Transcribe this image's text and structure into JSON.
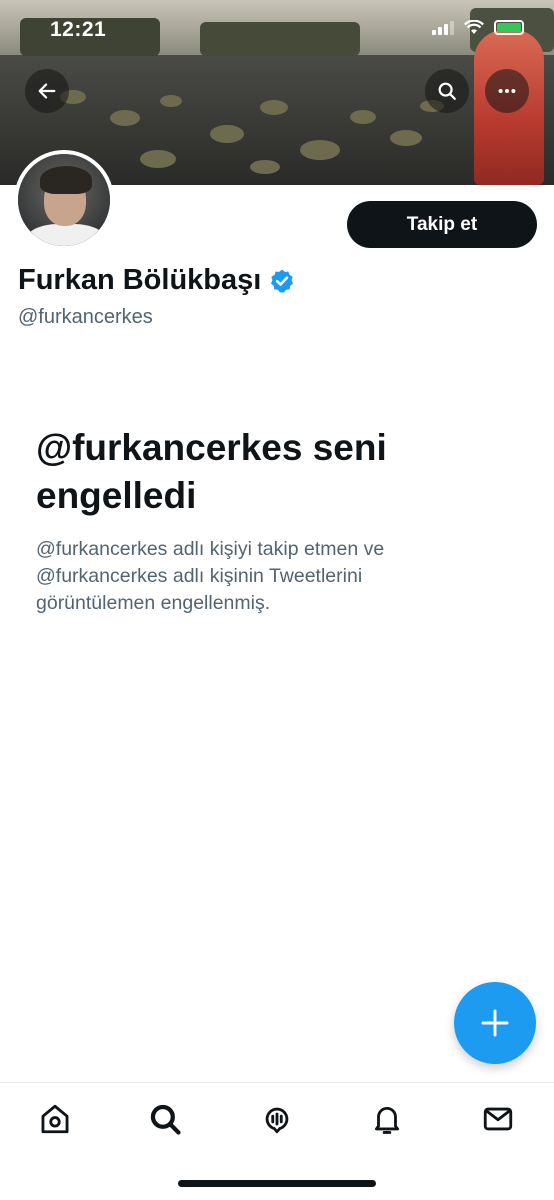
{
  "status_bar": {
    "time": "12:21"
  },
  "header": {
    "back_icon": "arrow-left-icon",
    "search_icon": "search-icon",
    "more_icon": "more-horizontal-icon"
  },
  "profile": {
    "display_name": "Furkan Bölükbaşı",
    "handle": "@furkancerkes",
    "verified": true,
    "follow_label": "Takip et"
  },
  "blocked": {
    "title": "@furkancerkes seni engelledi",
    "description": "@furkancerkes adlı kişiyi takip etmen ve @furkancerkes adlı kişinin Tweetlerini görüntülemen engellenmiş."
  },
  "tabbar": {
    "items": [
      {
        "name": "home",
        "icon": "home-icon"
      },
      {
        "name": "search",
        "icon": "search-icon"
      },
      {
        "name": "spaces",
        "icon": "spaces-icon"
      },
      {
        "name": "notifications",
        "icon": "bell-icon"
      },
      {
        "name": "messages",
        "icon": "mail-icon"
      }
    ]
  },
  "colors": {
    "accent": "#1d9bf0",
    "text_primary": "#0f1419",
    "text_secondary": "#536471",
    "battery": "#34c759"
  }
}
